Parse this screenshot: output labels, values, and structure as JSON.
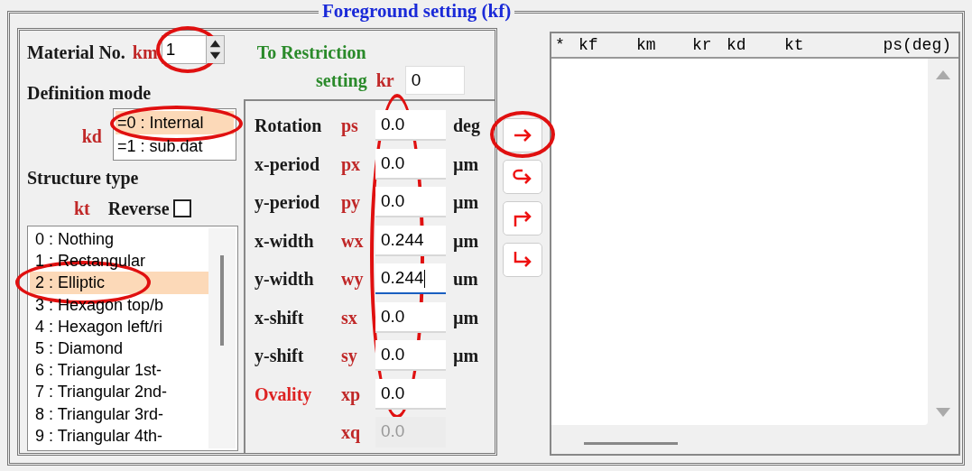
{
  "frame": {
    "title": "Foreground setting (kf)"
  },
  "material": {
    "label": "Material No.",
    "var": "km",
    "value": "1",
    "highlighted": true
  },
  "restriction": {
    "label_1": "To Restriction",
    "label_2": "setting",
    "var": "kr",
    "value": "0"
  },
  "definition": {
    "title": "Definition mode",
    "var": "kd",
    "options": [
      {
        "label": "=0 : Internal",
        "selected": true,
        "highlighted": true
      },
      {
        "label": "=1 : sub.dat",
        "selected": false,
        "highlighted": false
      }
    ]
  },
  "structure": {
    "title": "Structure type",
    "var": "kt",
    "reverse": {
      "label": "Reverse",
      "checked": false
    },
    "items": [
      {
        "label": "0 : Nothing",
        "selected": false,
        "highlighted": false
      },
      {
        "label": "1 : Rectangular",
        "selected": false,
        "highlighted": false
      },
      {
        "label": "2 : Elliptic",
        "selected": true,
        "highlighted": true
      },
      {
        "label": "3 : Hexagon top/b",
        "selected": false,
        "highlighted": false
      },
      {
        "label": "4 : Hexagon left/ri",
        "selected": false,
        "highlighted": false
      },
      {
        "label": "5 : Diamond",
        "selected": false,
        "highlighted": false
      },
      {
        "label": "6 : Triangular 1st-",
        "selected": false,
        "highlighted": false
      },
      {
        "label": "7 : Triangular 2nd-",
        "selected": false,
        "highlighted": false
      },
      {
        "label": "8 : Triangular 3rd-",
        "selected": false,
        "highlighted": false
      },
      {
        "label": "9 : Triangular 4th-",
        "selected": false,
        "highlighted": false
      }
    ]
  },
  "parameters": {
    "highlighted": true,
    "rows": [
      {
        "label": "Rotation",
        "color": "#1a1a1a",
        "var": "ps",
        "value": "0.0",
        "unit": "deg",
        "focused": false,
        "disabled": false
      },
      {
        "label": "x-period",
        "color": "#1a1a1a",
        "var": "px",
        "value": "0.0",
        "unit": "µm",
        "focused": false,
        "disabled": false
      },
      {
        "label": "y-period",
        "color": "#1a1a1a",
        "var": "py",
        "value": "0.0",
        "unit": "µm",
        "focused": false,
        "disabled": false
      },
      {
        "label": "x-width",
        "color": "#1a1a1a",
        "var": "wx",
        "value": "0.244",
        "unit": "µm",
        "focused": false,
        "disabled": false
      },
      {
        "label": "y-width",
        "color": "#1a1a1a",
        "var": "wy",
        "value": "0.244",
        "unit": "um",
        "focused": true,
        "disabled": false
      },
      {
        "label": "x-shift",
        "color": "#1a1a1a",
        "var": "sx",
        "value": "0.0",
        "unit": "µm",
        "focused": false,
        "disabled": false
      },
      {
        "label": "y-shift",
        "color": "#1a1a1a",
        "var": "sy",
        "value": "0.0",
        "unit": "µm",
        "focused": false,
        "disabled": false
      },
      {
        "label": "Ovality",
        "color": "#dd2222",
        "var": "xp",
        "value": "0.0",
        "focused": false,
        "disabled": false
      },
      {
        "var": "xq",
        "value": "0.0",
        "focused": false,
        "disabled": true
      }
    ]
  },
  "actions": [
    {
      "kind": "add",
      "highlighted": true
    },
    {
      "kind": "insert",
      "highlighted": false
    },
    {
      "kind": "up",
      "highlighted": false
    },
    {
      "kind": "down",
      "highlighted": false
    }
  ],
  "table": {
    "columns": [
      "*",
      "kf",
      "km",
      "kr",
      "kd",
      "kt",
      "ps(deg)"
    ]
  }
}
